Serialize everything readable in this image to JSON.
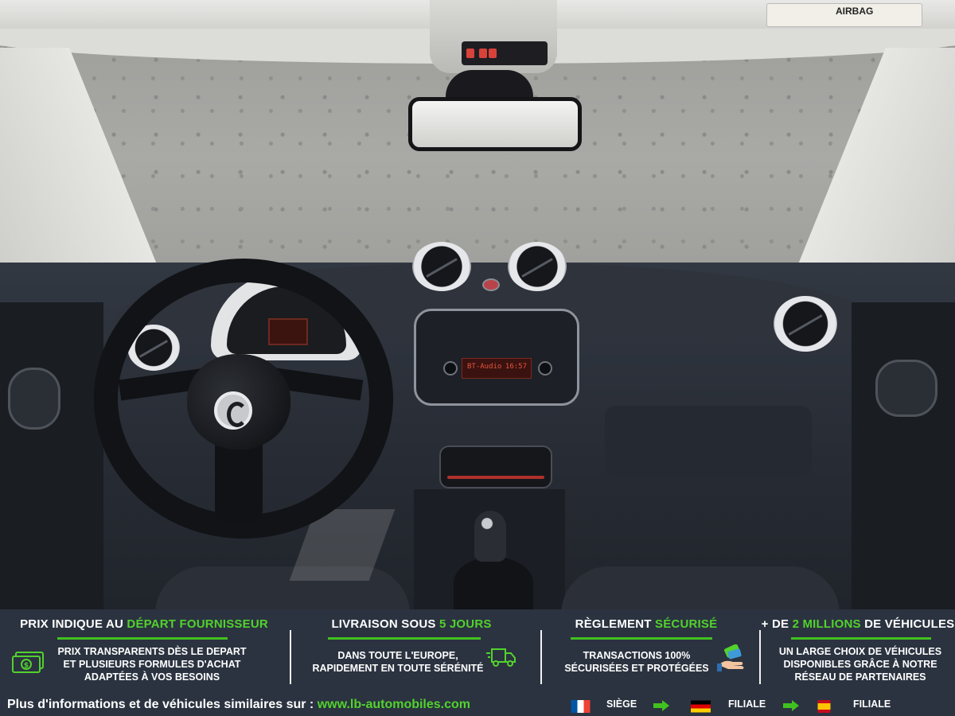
{
  "photo": {
    "subject": "car interior dashboard",
    "airbag_label": "AIRBAG",
    "radio_screen_text": "BT-Audio",
    "radio_clock": "16:57"
  },
  "features": [
    {
      "title_prefix": "PRIX INDIQUE AU ",
      "title_accent": "DÉPART FOURNISSEUR",
      "title_suffix": "",
      "lines": [
        "PRIX TRANSPARENTS DÈS LE DEPART",
        "ET PLUSIEURS FORMULES D'ACHAT",
        "ADAPTÉES À VOS BESOINS"
      ],
      "icon": "money-icon"
    },
    {
      "title_prefix": "LIVRAISON SOUS ",
      "title_accent": "5 JOURS",
      "title_suffix": "",
      "lines": [
        "DANS TOUTE L'EUROPE,",
        "RAPIDEMENT EN TOUTE SÉRÉNITÉ"
      ],
      "icon": "delivery-truck-icon"
    },
    {
      "title_prefix": "RÈGLEMENT ",
      "title_accent": "SÉCURISÉ",
      "title_suffix": "",
      "lines": [
        "TRANSACTIONS 100%",
        "SÉCURISÉES ET PROTÉGÉES"
      ],
      "icon": "payment-hand-icon"
    },
    {
      "title_prefix": "+ DE ",
      "title_accent": "2 MILLIONS",
      "title_suffix": " DE VÉHICULES",
      "lines": [
        "UN LARGE CHOIX DE VÉHICULES",
        "DISPONIBLES GRÂCE À NOTRE",
        "RÉSEAU DE PARTENAIRES"
      ],
      "icon": ""
    }
  ],
  "footer": {
    "info_text": "Plus d'informations et de véhicules similaires sur : ",
    "url": "www.lb-automobiles.com",
    "locations": [
      {
        "flag": "france-flag-icon",
        "label": "SIÈGE"
      },
      {
        "flag": "germany-flag-icon",
        "label": "FILIALE"
      },
      {
        "flag": "spain-flag-icon",
        "label": "FILIALE"
      }
    ]
  },
  "colors": {
    "banner_bg": "#2b3340",
    "accent_green": "#52d22d",
    "text": "#ffffff"
  }
}
